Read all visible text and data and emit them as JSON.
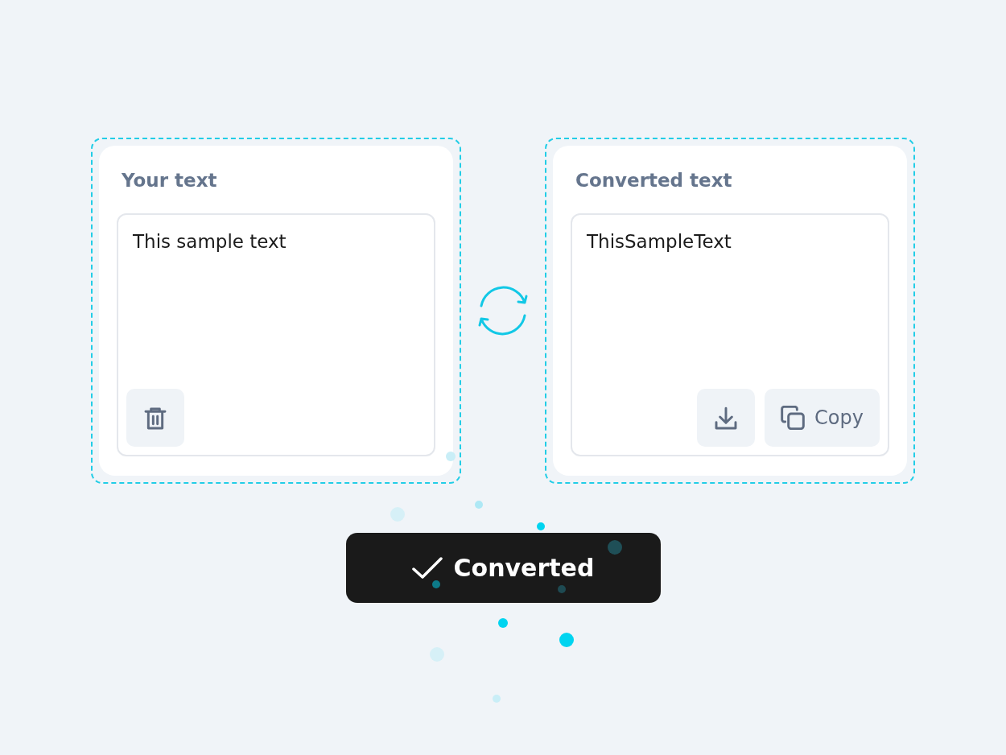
{
  "panels": [
    {
      "kind": "input",
      "title": "Your text",
      "text": "This sample text",
      "buttons": [
        {
          "kind": "delete"
        }
      ]
    },
    {
      "kind": "output",
      "title": "Converted text",
      "text": "ThisSampleText",
      "buttons": [
        {
          "kind": "download"
        },
        {
          "kind": "copy",
          "label": "Copy"
        }
      ]
    }
  ],
  "toast": {
    "text": "Converted"
  }
}
